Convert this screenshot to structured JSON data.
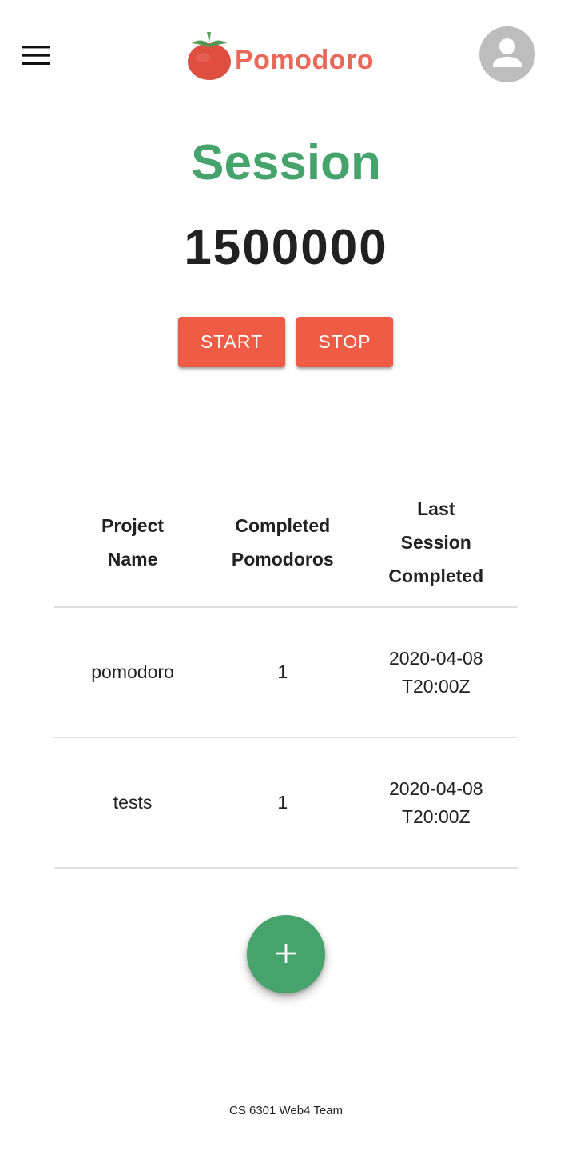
{
  "header": {
    "menu_icon": "hamburger-menu-icon",
    "logo_icon": "tomato-icon",
    "logo_text": "Pomodoro",
    "avatar_icon": "account-circle-icon"
  },
  "session": {
    "title": "Session",
    "timer_value": "1500000"
  },
  "controls": {
    "start_label": "START",
    "stop_label": "STOP"
  },
  "table": {
    "headers": [
      "Project Name",
      "Completed Pomodoros",
      "Last Session Completed"
    ],
    "rows": [
      {
        "project": "pomodoro",
        "completed": "1",
        "last_session": "2020-04-08T20:00Z"
      },
      {
        "project": "tests",
        "completed": "1",
        "last_session": "2020-04-08T20:00Z"
      }
    ]
  },
  "fab": {
    "icon": "add-icon"
  },
  "footer": {
    "text": "CS 6301 Web4 Team"
  },
  "colors": {
    "primary_red": "#ef5b44",
    "logo_red": "#e8685a",
    "primary_green": "#46a36c",
    "avatar_gray": "#bdbdbd"
  }
}
